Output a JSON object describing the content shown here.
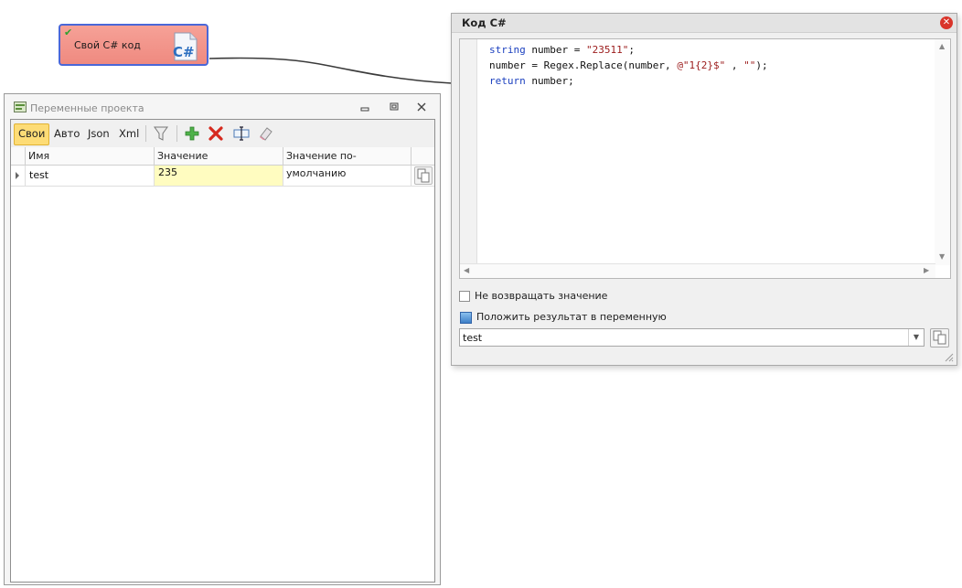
{
  "node": {
    "title": "Свой C# код",
    "status_icon": "check-icon",
    "type_icon": "csharp-file-icon"
  },
  "variables_panel": {
    "title": "Переменные проекта",
    "window_buttons": [
      "minimize",
      "restore",
      "close"
    ],
    "tabs": [
      {
        "label": "Свои",
        "active": true
      },
      {
        "label": "Авто",
        "active": false
      },
      {
        "label": "Json",
        "active": false
      },
      {
        "label": "Xml",
        "active": false
      }
    ],
    "toolbar_icons": [
      "filter-icon",
      "add-icon",
      "delete-icon",
      "rename-icon",
      "clear-icon"
    ],
    "columns": [
      "Имя",
      "Значение",
      "Значение по-умолчанию"
    ],
    "rows": [
      {
        "name": "test",
        "value": "235",
        "default": ""
      }
    ]
  },
  "code_window": {
    "title": "Код C#",
    "code_lines": [
      {
        "parts": [
          {
            "t": "string",
            "c": "kw"
          },
          {
            "t": " number = ",
            "c": ""
          },
          {
            "t": "\"23511\"",
            "c": "str"
          },
          {
            "t": ";",
            "c": ""
          }
        ]
      },
      {
        "parts": [
          {
            "t": "number = Regex.Replace(number, ",
            "c": ""
          },
          {
            "t": "@\"1{2}$\"",
            "c": "str"
          },
          {
            "t": " , ",
            "c": ""
          },
          {
            "t": "\"\"",
            "c": "str"
          },
          {
            "t": ");",
            "c": ""
          }
        ]
      },
      {
        "parts": [
          {
            "t": "return",
            "c": "kw"
          },
          {
            "t": " number;",
            "c": ""
          }
        ]
      }
    ],
    "no_return_label": "Не возвращать значение",
    "no_return_checked": false,
    "put_result_label": "Положить результат в переменную",
    "result_variable": "test"
  },
  "colors": {
    "node_fill": "#f29a90",
    "node_border": "#4a67d8",
    "active_tab": "#fddc76",
    "value_cell": "#fffcc0",
    "keyword": "#1a3fbf",
    "string": "#9b1b1b"
  }
}
